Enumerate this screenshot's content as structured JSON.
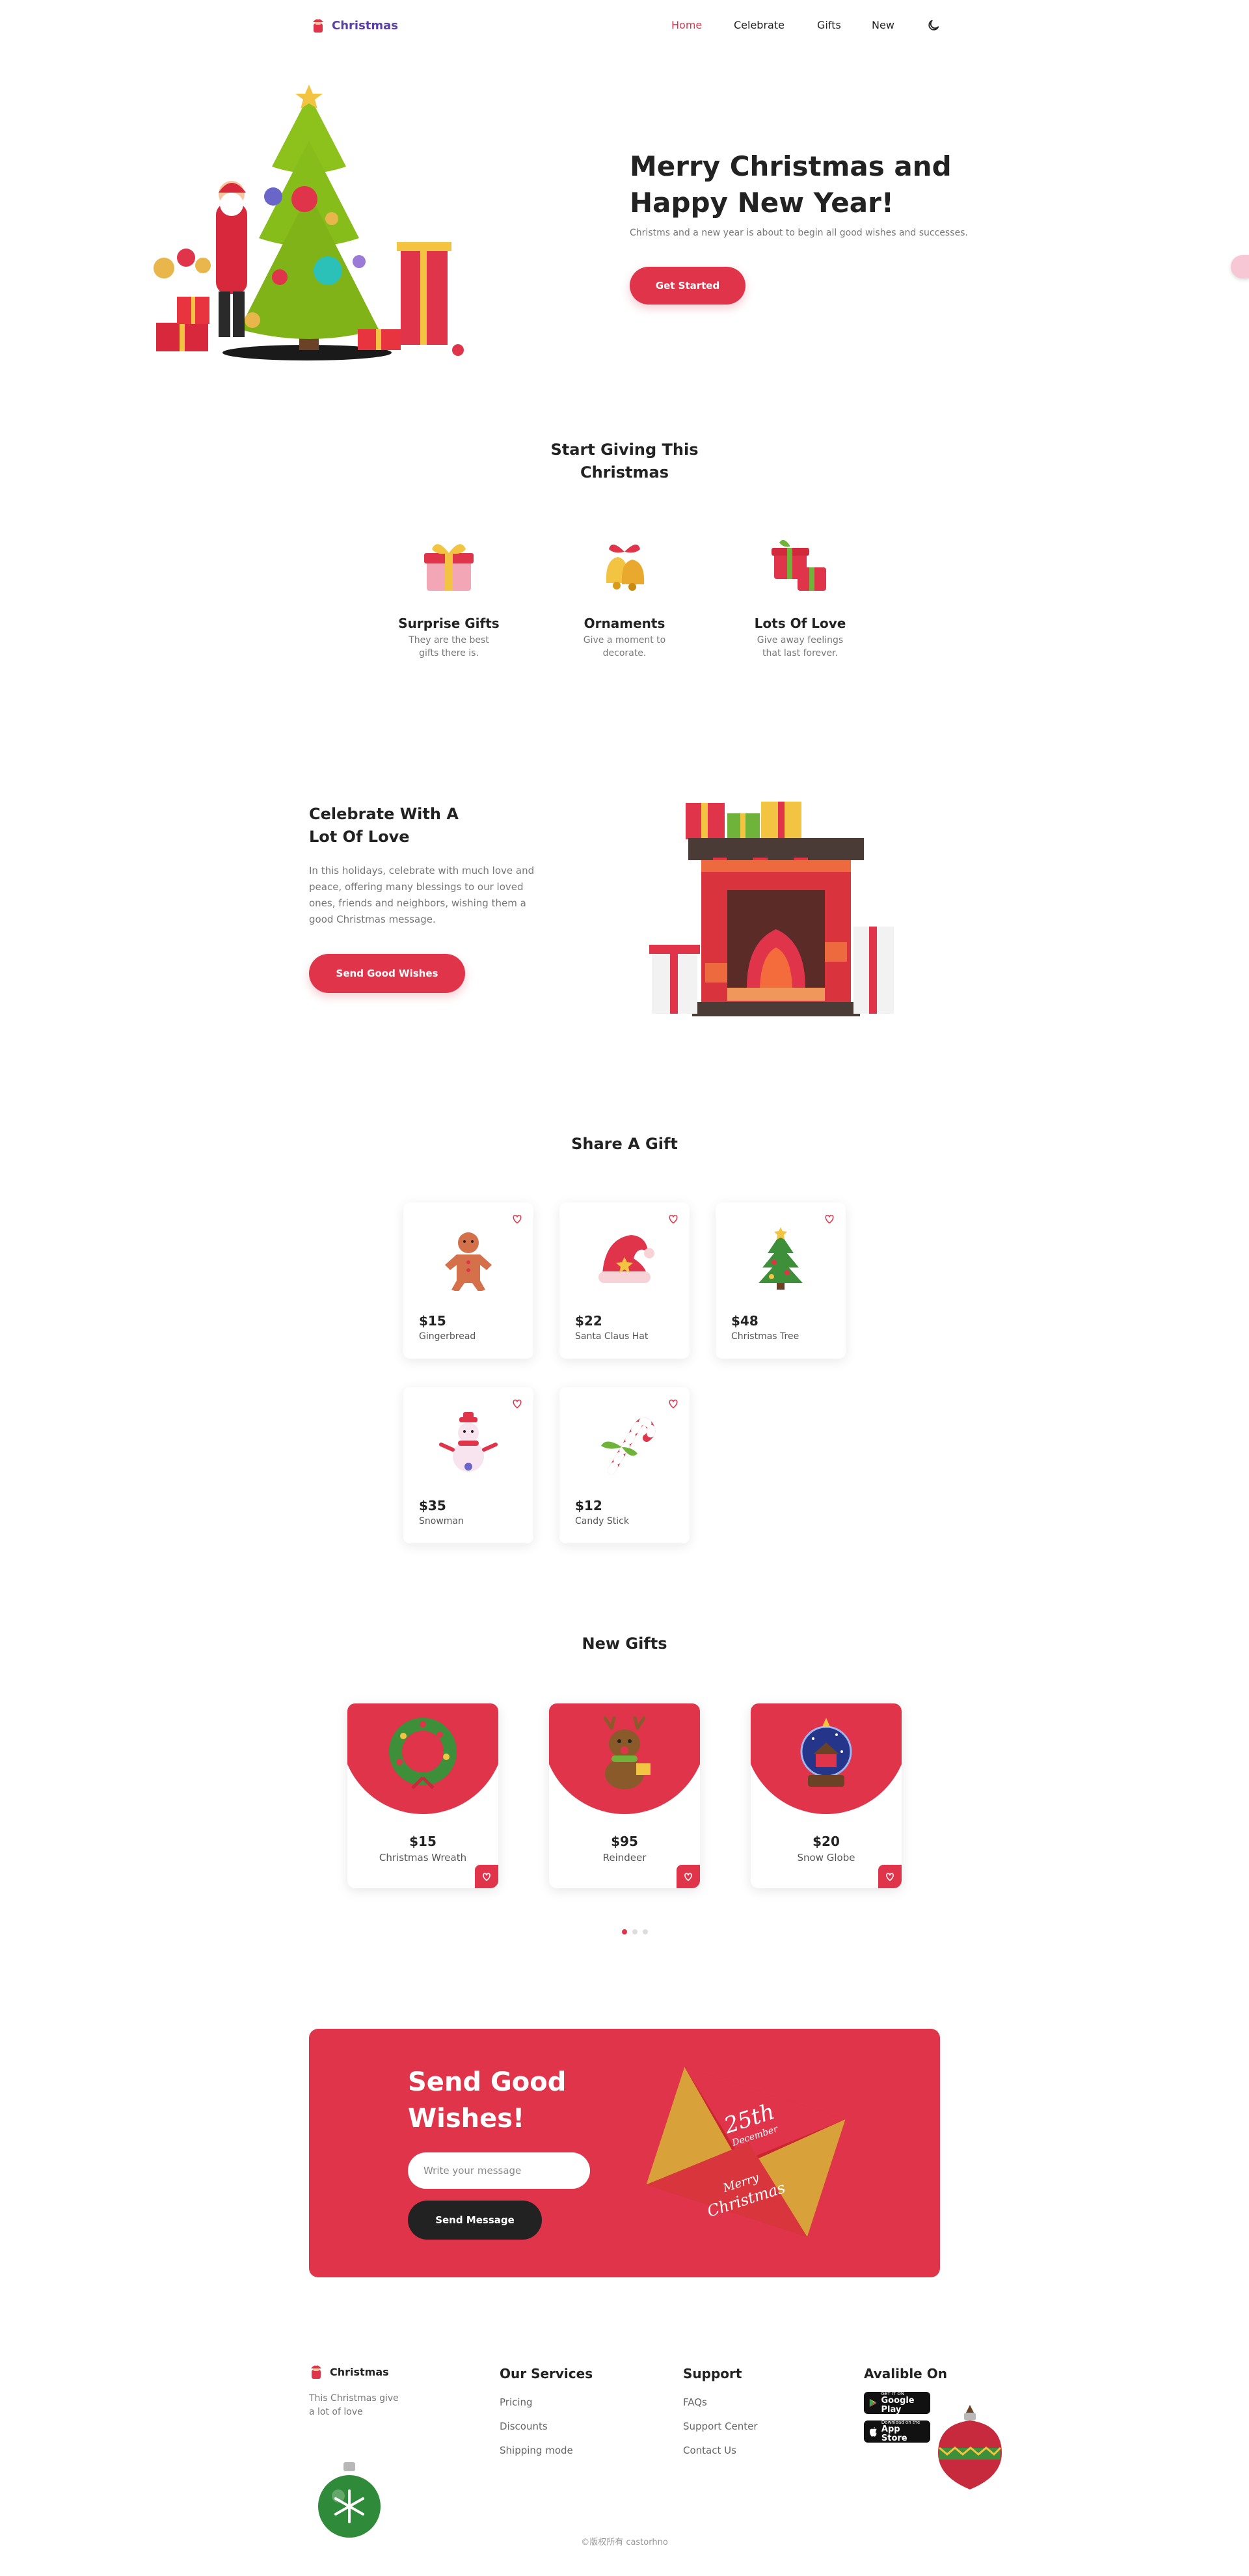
{
  "header": {
    "logo_text": "Christmas",
    "nav": [
      {
        "label": "Home",
        "active": true
      },
      {
        "label": "Celebrate",
        "active": false
      },
      {
        "label": "Gifts",
        "active": false
      },
      {
        "label": "New",
        "active": false
      }
    ],
    "theme_icon": "moon-icon"
  },
  "hero": {
    "title_line1": "Merry Christmas and",
    "title_line2": "Happy New Year!",
    "subtitle": "Christms and a new year is about to begin all good wishes and successes.",
    "cta": "Get Started"
  },
  "giving": {
    "title_line1": "Start Giving This",
    "title_line2": "Christmas",
    "items": [
      {
        "title": "Surprise Gifts",
        "desc_line1": "They are the best",
        "desc_line2": "gifts there is."
      },
      {
        "title": "Ornaments",
        "desc_line1": "Give a moment to",
        "desc_line2": "decorate."
      },
      {
        "title": "Lots Of Love",
        "desc_line1": "Give away feelings",
        "desc_line2": "that last forever."
      }
    ]
  },
  "celebrate": {
    "title_line1": "Celebrate With A",
    "title_line2": "Lot Of Love",
    "text_line1": "In this holidays, celebrate with much love and",
    "text_line2": "peace, offering many blessings to our loved",
    "text_line3": "ones, friends and neighbors, wishing them a",
    "text_line4": "good Christmas message.",
    "cta": "Send Good Wishes"
  },
  "share": {
    "title": "Share A Gift",
    "gifts": [
      {
        "price": "$15",
        "name": "Gingerbread"
      },
      {
        "price": "$22",
        "name": "Santa Claus Hat"
      },
      {
        "price": "$48",
        "name": "Christmas Tree"
      },
      {
        "price": "$35",
        "name": "Snowman"
      },
      {
        "price": "$12",
        "name": "Candy Stick"
      }
    ]
  },
  "new_gifts": {
    "title": "New Gifts",
    "items": [
      {
        "price": "$15",
        "name": "Christmas Wreath"
      },
      {
        "price": "$95",
        "name": "Reindeer"
      },
      {
        "price": "$20",
        "name": "Snow Globe"
      }
    ],
    "active_page": 1,
    "page_count": 3
  },
  "wishes": {
    "title_line1": "Send Good",
    "title_line2": "Wishes!",
    "input_placeholder": "Write your message",
    "button": "Send Message",
    "envelope_text1": "25th",
    "envelope_text2": "December",
    "envelope_text3": "Merry",
    "envelope_text4": "Christmas"
  },
  "footer": {
    "logo_text": "Christmas",
    "tagline_line1": "This Christmas give",
    "tagline_line2": "a lot of love",
    "services_title": "Our Services",
    "services": [
      "Pricing",
      "Discounts",
      "Shipping mode"
    ],
    "support_title": "Support",
    "support": [
      "FAQs",
      "Support Center",
      "Contact Us"
    ],
    "available_title": "Avalible On",
    "google_small": "GET IT ON",
    "google_big": "Google Play",
    "apple_small": "Download on the",
    "apple_big": "App Store",
    "copyright": "©版权所有 castorhno"
  },
  "colors": {
    "accent": "#e0344a",
    "logo": "#5a3fa8",
    "dark": "#222222"
  }
}
